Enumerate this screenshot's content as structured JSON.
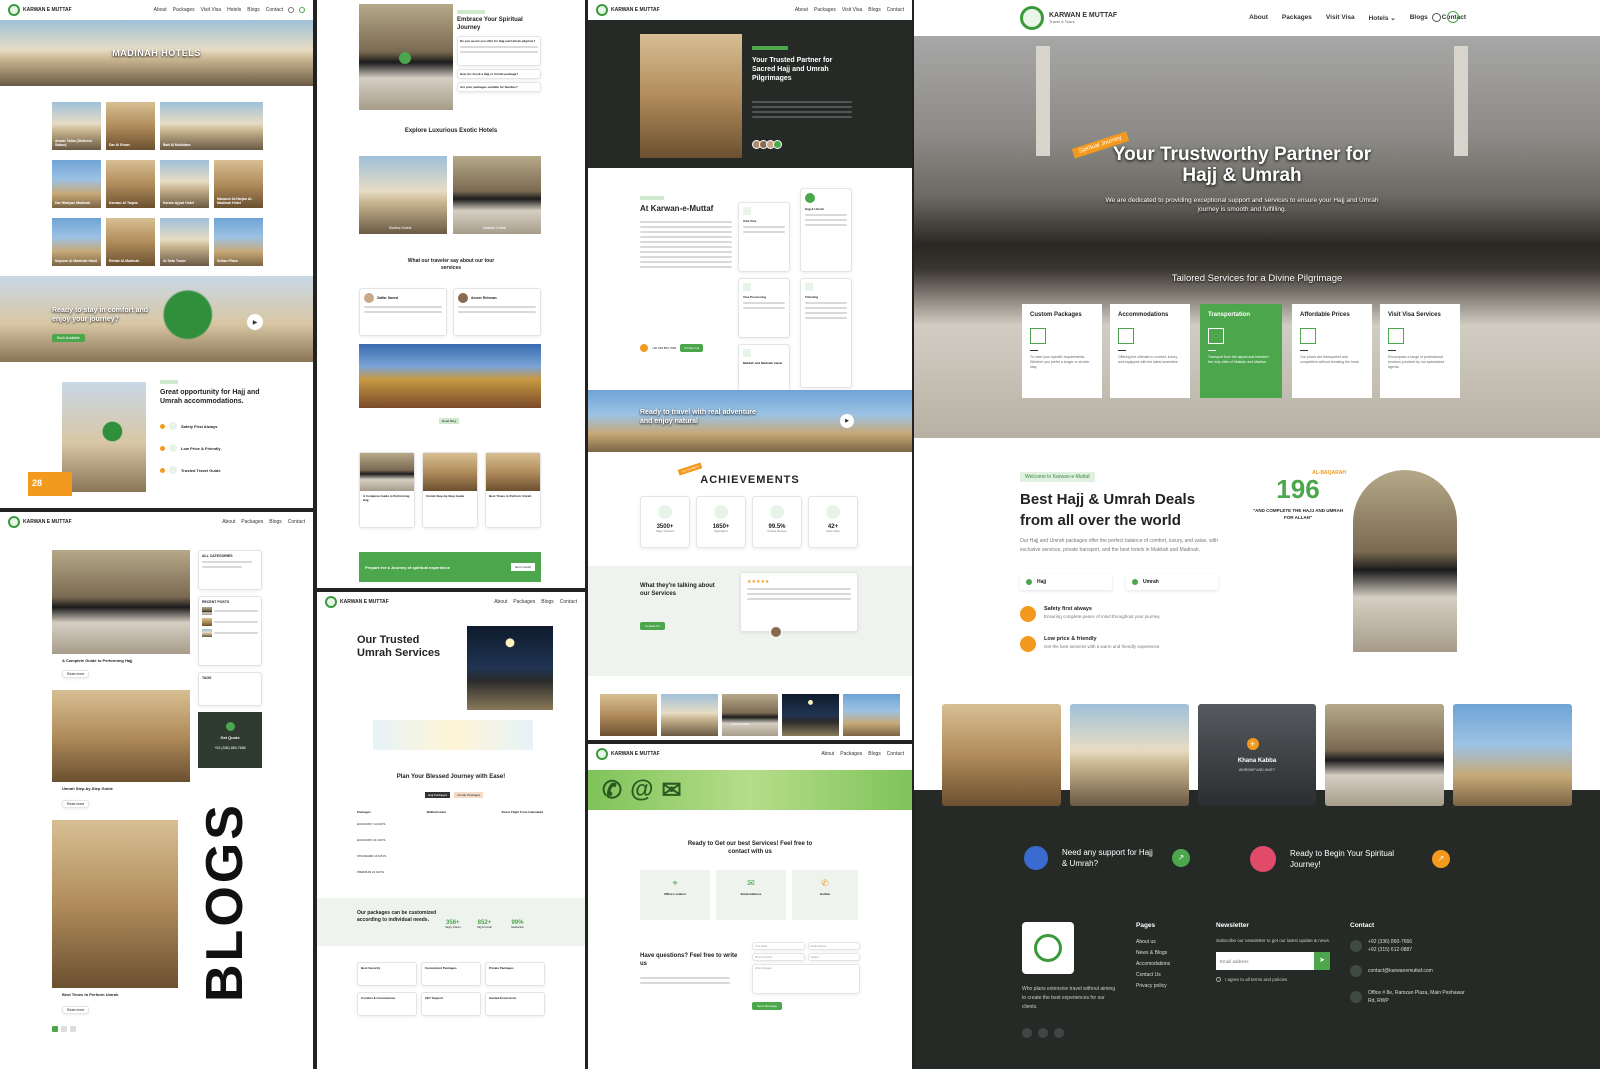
{
  "brand": {
    "name": "KARWAN E MUTTAF",
    "tagline": "Travel & Tours",
    "green": "#4ca64c",
    "orange": "#f39a1e",
    "dark": "#262a26"
  },
  "nav": {
    "items": [
      "About",
      "Packages",
      "Visit Visa",
      "Hotels",
      "Blogs",
      "Contact"
    ]
  },
  "p1": {
    "hero": "MADINAH HOTELS",
    "hotels": [
      "Anwar Taiba (Shaheen Salam)",
      "Dar Al Eman",
      "Bait Al Mukhtara",
      "Dar Wadyan Madinah",
      "Karwan Al Taqwa",
      "Karam Ajyad Hotel",
      "Manazel Al-Harjan Al-Madinah Hotel",
      "Nujoom Al Madinah Hotel",
      "Rehab Al-Madinah",
      "Al Safa Tower",
      "Sultan Plaza"
    ],
    "banner": "Ready to stay in comfort and enjoy your journey?",
    "banner_btn": "Book Available",
    "opp_title": "Great opportunity for Hajj and Umrah accommodations.",
    "opp_items": [
      "Safety First Always",
      "Low Price & Friendly",
      "Trusted Travel Guide"
    ],
    "badge_num": "28"
  },
  "p2": {
    "embrace_title": "Embrace Your Spiritual Journey",
    "faqs": [
      "Do you assist you offer for Hajj and Umrah pilgrims?",
      "How do I book a Hajj or Umrah package?",
      "Are your packages suitable for families?"
    ],
    "hotels_title": "Explore Luxurious Exotic Hotels",
    "hotel_cards": [
      "Madina Hotels",
      "Makkah Hotels"
    ],
    "testimonials_title": "What our traveler say about our tour services",
    "reviewers": [
      "Zaffar Saeed",
      "Ameer Rehman"
    ],
    "blog_label": "Read Blog",
    "blogs": [
      "A Complete Guide to Performing Hajj",
      "Umrah Step-by-Step Guide",
      "Best Times to Perform Umrah"
    ],
    "cta": "Prepare for a Journey of spiritual experience",
    "cta_btn": "Get in touch"
  },
  "p3": {
    "title": "Your Trusted Partner for Sacred Hajj and Umrah Pilgrimages",
    "about_label": "About Karwan",
    "about_title": "At Karwan-e-Muttaf",
    "services": [
      "Visit Visa",
      "Hajj & Umrah",
      "Visa Processing",
      "Ticketing",
      "Makkah and Madinah Ziarat"
    ],
    "phone_label": "+92 336 860 7666",
    "btn": "Contact Us",
    "travel_banner": "Ready to travel with real adventure and enjoy natural",
    "ach_tag": "Our Numbers",
    "achievements_title": "ACHIEVEMENTS",
    "ach": [
      {
        "v": "3500+",
        "l": "Happy Travelers"
      },
      {
        "v": "1650+",
        "l": "Hajj Pilgrims"
      },
      {
        "v": "99.5%",
        "l": "Positive Reviews"
      },
      {
        "v": "42+",
        "l": "Years of Exp."
      }
    ],
    "talking_title": "What they're talking about our Services",
    "talking_btn": "Contact Us",
    "gallery_label": "Khana Kabba"
  },
  "p4": {
    "title": "Our Trusted Umrah Services",
    "plan_title": "Plan Your Blessed Journey with Ease!",
    "tabs": [
      "Hajj Packages",
      "Umrah Packages"
    ],
    "table_head": [
      "Packages",
      "Makkah Hotel",
      "Madinah Hotel",
      "Direct Flight From Islamabad"
    ],
    "rows": [
      "ECONOMY 14 DAYS",
      "ECONOMY 21 DAYS",
      "STANDARD 14 DAYS",
      "PREMIUM 21 DAYS"
    ],
    "custom_title": "Our packages can be customized according to individual needs.",
    "stats": [
      {
        "v": "356+",
        "l": "Happy Clients"
      },
      {
        "v": "852+",
        "l": "Hajj & Umrah"
      },
      {
        "v": "99%",
        "l": "Satisfaction"
      }
    ],
    "features": [
      "Best Security",
      "Customized Packages",
      "Private Packages",
      "Comfort & Convenience",
      "24/7 Support",
      "Guided Excursions"
    ]
  },
  "p5": {
    "title": "Ready to Get our best Services! Feel free to contact with us",
    "contacts": [
      "Office Location",
      "Email Address",
      "Hotline"
    ],
    "q_title": "Have questions? Feel free to write us",
    "fields": [
      "Your Name",
      "Email Address",
      "Phone Number",
      "Subject",
      "Write Message"
    ],
    "send_btn": "Send Message"
  },
  "p6": {
    "hero_tag": "Spiritual Journey",
    "hero_title": "Your Trustworthy Partner for Hajj & Umrah",
    "hero_sub": "We are dedicated to providing exceptional support and services to ensure your Hajj and Umrah journey is smooth and fulfilling.",
    "tailored": "Tailored Services for a Divine Pilgrimage",
    "service_cards": [
      {
        "t": "Custom Packages",
        "d": "To meet your specific requirements. Whether you prefer a longer or shorter stay."
      },
      {
        "t": "Accommodations",
        "d": "Offering the ultimate in comfort, luxury, and equipped with the latest amenities."
      },
      {
        "t": "Transportation",
        "d": "Transport from the airport and between the holy cities of Makkah and Madina."
      },
      {
        "t": "Affordable Prices",
        "d": "Our prices are transparent and competitive without breaking the bank."
      },
      {
        "t": "Visit Visa Services",
        "d": "Encompass a range of professional services provided by our specialized agents."
      }
    ],
    "welcome_tag": "Welcome to Karwan-e-Muttaf",
    "deals_title": "Best Hajj & Umrah Deals from all over the world",
    "deals_desc": "Our Hajj and Umrah packages offer the perfect balance of comfort, luxury, and value, with exclusive services, private transport, and the best hotels in Makkah and Madinah.",
    "checks": [
      "Hajj",
      "Umrah"
    ],
    "features": [
      {
        "t": "Safety first always",
        "d": "Ensuring complete peace of mind throughout your journey."
      },
      {
        "t": "Low price & friendly",
        "d": "Get the best services with a warm and friendly experience."
      }
    ],
    "verse_num": "196",
    "verse_ref": "AL-BAQARAH",
    "verse_text": "\"AND COMPLETE THE HAJJ AND UMRAH FOR ALLAH\"",
    "gallery_caption": "Khana Kabba",
    "gallery_sub": "WORSHIP AND UNITY",
    "support": "Need any support for Hajj & Umrah?",
    "begin": "Ready to Begin Your Spiritual Journey!",
    "footer": {
      "about": "Who plans extensive travel without aiming to create the best experiences for our clients.",
      "pages_title": "Pages",
      "pages": [
        "About us",
        "News & Blogs",
        "Accomodations",
        "Contact Us",
        "Privacy policy"
      ],
      "newsletter_title": "Newsletter",
      "newsletter_desc": "Subscribe our newsletter to get our latest update & news.",
      "email_placeholder": "Email address",
      "agree": "I agree to all terms and policies",
      "contact_title": "Contact",
      "phones": [
        "+92 (336) 860-7666",
        "+92 (315) 612-0887"
      ],
      "email": "contact@karwanemuttaf.com",
      "address": "Office # 8e, Ramzan Plaza, Main Peshawar Rd, RWP"
    }
  },
  "blogs_side": "BLOGS",
  "blogs_page": {
    "posts": [
      "A Complete Guide to Performing Hajj",
      "Umrah Step-by-Step Guide",
      "Best Times to Perform Umrah"
    ],
    "read_more": "Read more",
    "categories_title": "ALL CATEGORIES",
    "recent_title": "RECENT POSTS",
    "tags_title": "TAGS",
    "quote_title": "Get Quote",
    "quote_phone": "+92-(336)-860-7666"
  }
}
